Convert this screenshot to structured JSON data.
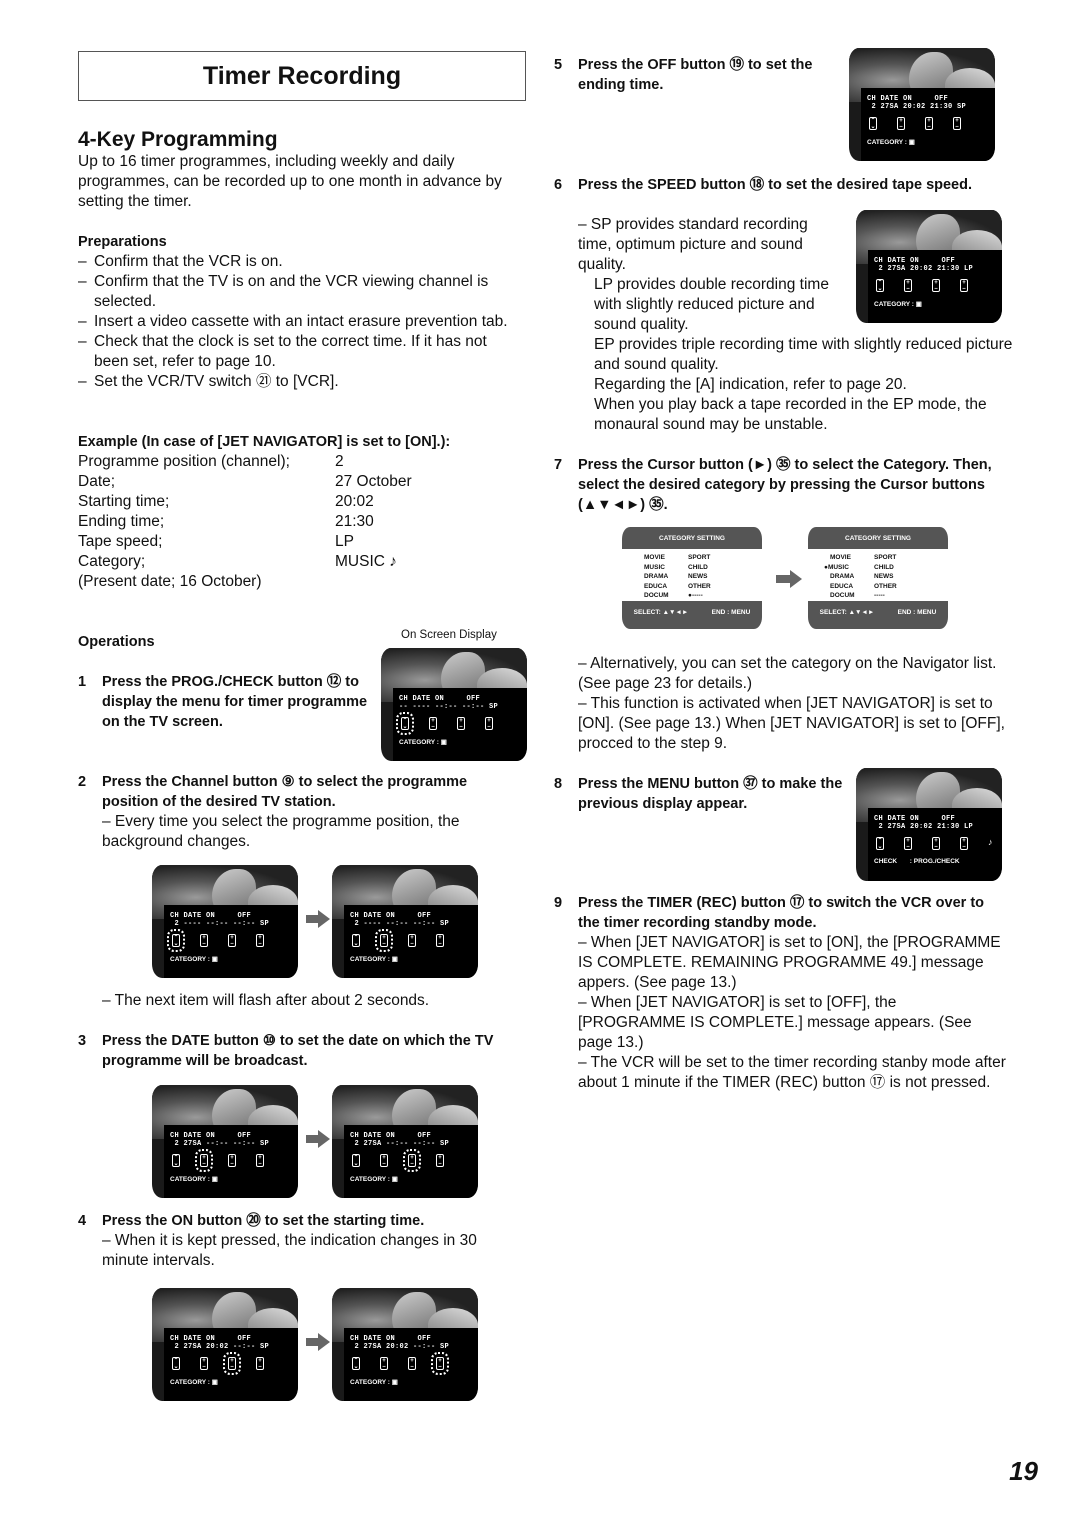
{
  "page": {
    "title": "Timer  Recording",
    "section_title": "4-Key Programming",
    "intro": "Up to 16 timer programmes, including weekly and daily programmes, can be recorded up to one month in advance by setting the timer.",
    "page_number": "19"
  },
  "preparations": {
    "heading": "Preparations",
    "items": [
      "Confirm that the VCR is on.",
      "Confirm that the TV is on and the VCR viewing channel is selected.",
      "Insert a video cassette with an intact erasure prevention tab.",
      "Check that the clock is set to the correct time. If it has not been set, refer to page 10.",
      "Set the VCR/TV switch ㉑ to [VCR]."
    ]
  },
  "example": {
    "heading": "Example (In case of [JET NAVIGATOR] is set to [ON].):",
    "rows": [
      {
        "k": "Programme position (channel);",
        "v": "2"
      },
      {
        "k": "Date;",
        "v": "27 October"
      },
      {
        "k": "Starting time;",
        "v": "20:02"
      },
      {
        "k": "Ending time;",
        "v": "21:30"
      },
      {
        "k": "Tape speed;",
        "v": "LP"
      },
      {
        "k": "Category;",
        "v": "MUSIC ♪"
      }
    ],
    "note": "(Present date; 16 October)"
  },
  "operations": {
    "heading": "Operations",
    "osd_caption": "On Screen Display"
  },
  "steps": {
    "s1": {
      "n": "1",
      "text": "Press the PROG./CHECK button ⑫ to display the menu for timer programme on the TV screen."
    },
    "s2": {
      "n": "2",
      "text": "Press the Channel button ⑨ to select the programme position of the desired TV station.",
      "sub": "– Every time you select the programme position, the background changes.",
      "sub2": "– The next item will flash after about 2 seconds."
    },
    "s3": {
      "n": "3",
      "text": "Press the DATE button ⑩ to set the date on which the TV programme will be broadcast."
    },
    "s4": {
      "n": "4",
      "text": "Press the ON button ⑳ to set the starting time.",
      "sub": "– When it is kept pressed, the indication changes in 30 minute intervals."
    },
    "s5": {
      "n": "5",
      "text": "Press the OFF button ⑲ to set the ending time."
    },
    "s6": {
      "n": "6",
      "text": "Press the SPEED button ⑱ to set the desired tape speed.",
      "sub": "– SP provides standard recording time, optimum picture and sound quality.",
      "sub_lp": "LP provides double recording time with slightly reduced picture and sound quality.",
      "sub_ep": "EP provides triple recording time with slightly reduced picture and sound quality.",
      "sub_a": "Regarding the [A] indication, refer to page 20.",
      "sub_mono": "When you play back a tape recorded in the EP mode, the monaural sound may be unstable."
    },
    "s7": {
      "n": "7",
      "text": "Press the Cursor button (►) ㉟ to select the Category. Then, select the desired category by pressing the Cursor buttons (▲▼◄►) ㉟.",
      "sub1": "– Alternatively, you can set the category on the Navigator list. (See page 23 for details.)",
      "sub2": "– This function is activated when [JET NAVIGATOR] is set to [ON]. (See page 13.) When [JET NAVIGATOR] is set to [OFF], procced to the step 9."
    },
    "s8": {
      "n": "8",
      "text": "Press the MENU button ㊲ to make the previous display appear."
    },
    "s9": {
      "n": "9",
      "text": "Press the TIMER (REC) button ⑰ to switch the VCR over to the timer recording standby mode.",
      "sub1": "– When [JET NAVIGATOR] is set to [ON], the [PROGRAMME IS COMPLETE. REMAINING PROGRAMME 49.] message appers. (See page 13.)",
      "sub2": "– When [JET NAVIGATOR] is set to [OFF], the [PROGRAMME IS COMPLETE.] message appears. (See page 13.)",
      "sub3": "– The VCR will be set to the timer recording stanby mode after about 1 minute if the TIMER (REC) button ⑰ is not pressed."
    }
  },
  "osd": {
    "header": "CH DATE ON     OFF",
    "category_label": "CATEGORY :",
    "check_label": "CHECK",
    "prog_check_label": ": PROG./CHECK",
    "screens": {
      "s1": "-- ---- --:-- --:-- SP",
      "s2a": " 2 ---- --:-- --:-- SP",
      "s2b": " 2 ---- --:-- --:-- SP",
      "s3a": " 2 27SA --:-- --:-- SP",
      "s3b": " 2 27SA --:-- --:-- SP",
      "s4a": " 2 27SA 20:02 --:-- SP",
      "s4b": " 2 27SA 20:02 --:-- SP",
      "s5": " 2 27SA 20:02 21:30 SP",
      "s6": " 2 27SA 20:02 21:30 LP",
      "s8": " 2 27SA 20:02 21:30 LP"
    }
  },
  "category_setting": {
    "title": "CATEGORY SETTING",
    "items": [
      "MOVIE",
      "SPORT",
      "MUSIC",
      "CHILD",
      "DRAMA",
      "NEWS",
      "EDUCA",
      "OTHER",
      "DOCUM",
      "-----"
    ],
    "select_label": "SELECT: ▲▼◄►",
    "end_label": "END : MENU",
    "selected_before": "-----",
    "selected_after": "MUSIC"
  }
}
